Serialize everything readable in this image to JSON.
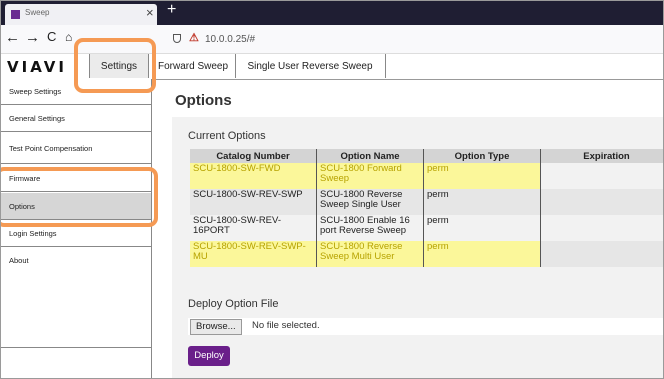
{
  "browser": {
    "tab_title": "Sweep",
    "close_glyph": "×",
    "new_tab_glyph": "+",
    "back_glyph": "←",
    "forward_glyph": "→",
    "reload_glyph": "C",
    "home_glyph": "⌂",
    "url": "10.0.0.25/#"
  },
  "header": {
    "logo": "VIAVI",
    "tabs": [
      {
        "label": "Settings"
      },
      {
        "label": "Forward Sweep"
      },
      {
        "label": "Single User Reverse Sweep"
      }
    ]
  },
  "sidebar": {
    "items": [
      {
        "label": "Sweep Settings"
      },
      {
        "label": "General Settings"
      },
      {
        "label": "Test Point Compensation"
      },
      {
        "label": "Firmware"
      },
      {
        "label": "Options"
      },
      {
        "label": "Login Settings"
      },
      {
        "label": "About"
      }
    ]
  },
  "main": {
    "title": "Options",
    "current_options_heading": "Current Options",
    "columns": [
      "Catalog Number",
      "Option Name",
      "Option Type",
      "Expiration"
    ],
    "rows": [
      {
        "catalog": "SCU-1800-SW-FWD",
        "name": "SCU-1800 Forward Sweep",
        "type": "perm",
        "expiration": ""
      },
      {
        "catalog": "SCU-1800-SW-REV-SWP",
        "name": "SCU-1800 Reverse Sweep Single User",
        "type": "perm",
        "expiration": ""
      },
      {
        "catalog": "SCU-1800-SW-REV-16PORT",
        "name": "SCU-1800 Enable 16 port Reverse Sweep",
        "type": "perm",
        "expiration": ""
      },
      {
        "catalog": "SCU-1800-SW-REV-SWP-MU",
        "name": "SCU-1800 Reverse Sweep Multi User",
        "type": "perm",
        "expiration": ""
      }
    ],
    "deploy_heading": "Deploy Option File",
    "browse_label": "Browse...",
    "no_file_text": "No file selected.",
    "deploy_label": "Deploy"
  },
  "colors": {
    "highlight": "#fbf79a",
    "callout": "#f59a54",
    "deploy_button": "#6a1f8a"
  }
}
